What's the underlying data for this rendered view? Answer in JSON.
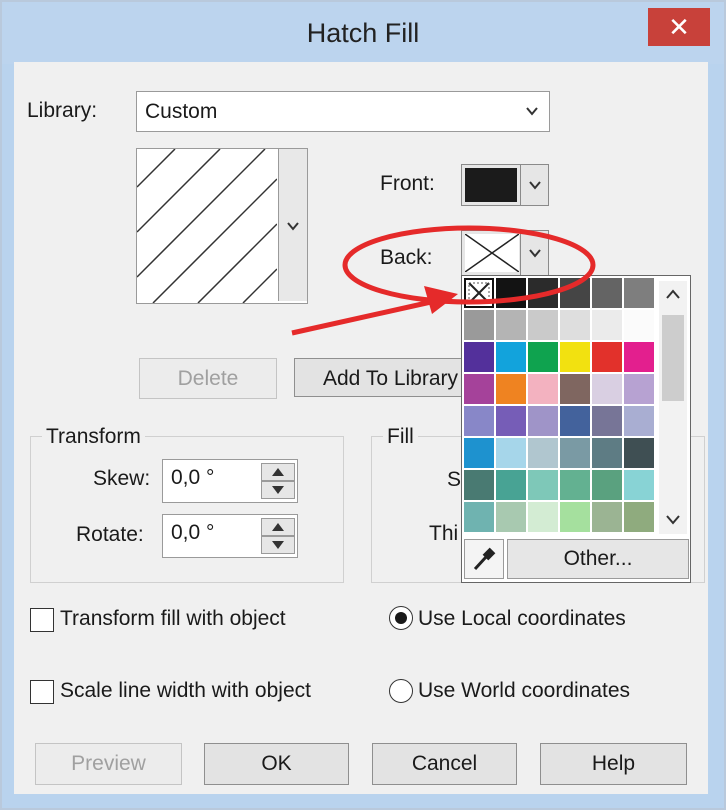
{
  "window": {
    "title": "Hatch Fill",
    "close_glyph": "✕"
  },
  "library": {
    "label": "Library:",
    "value": "Custom"
  },
  "front": {
    "label": "Front:",
    "color": "#1b1b1b"
  },
  "back": {
    "label": "Back:"
  },
  "buttons": {
    "delete": "Delete",
    "add_to_library": "Add To Library",
    "other": "Other...",
    "preview": "Preview",
    "ok": "OK",
    "cancel": "Cancel",
    "help": "Help"
  },
  "transform": {
    "label": "Transform",
    "skew_label": "Skew:",
    "skew_value": "0,0 °",
    "rotate_label": "Rotate:",
    "rotate_value": "0,0 °"
  },
  "fill": {
    "label": "Fill",
    "row1_partial": "S",
    "row2_partial": "Thi"
  },
  "options": {
    "transform_fill": "Transform fill with object",
    "transform_fill_checked": false,
    "scale_line": "Scale line width with object",
    "scale_line_checked": false,
    "local_coords": "Use Local coordinates",
    "local_selected": true,
    "world_coords": "Use World coordinates",
    "world_selected": false
  },
  "palette": {
    "rows": [
      [
        "none",
        "#131313",
        "#2b2b2b",
        "#454545",
        "#646464",
        "#7e7e7e"
      ],
      [
        "#9a9a9a",
        "#b4b4b4",
        "#cacaca",
        "#dedede",
        "#ebebeb",
        "#fbfbfb"
      ],
      [
        "#53309b",
        "#12a3dc",
        "#0fa34f",
        "#f2e110",
        "#e2312b",
        "#e31f8e"
      ],
      [
        "#a5429a",
        "#ef8321",
        "#f3b2c0",
        "#7f6660",
        "#d9cfe2",
        "#b7a2d2"
      ],
      [
        "#8887c8",
        "#765db7",
        "#9f94c8",
        "#43629c",
        "#777597",
        "#a9aed2"
      ],
      [
        "#1e92cf",
        "#a6d6ea",
        "#b0c6cf",
        "#7a9aa4",
        "#5e7c84",
        "#3f4f53"
      ],
      [
        "#497a72",
        "#48a394",
        "#7ec8b8",
        "#63b191",
        "#5aa17f",
        "#88d3d5"
      ],
      [
        "#6fb3b0",
        "#a8c9b0",
        "#d3ecd3",
        "#a5e09e",
        "#9bb493",
        "#8fab7e"
      ]
    ]
  },
  "annotation": {
    "ellipse_color": "#e52a2a",
    "arrow_color": "#e52a2a"
  }
}
